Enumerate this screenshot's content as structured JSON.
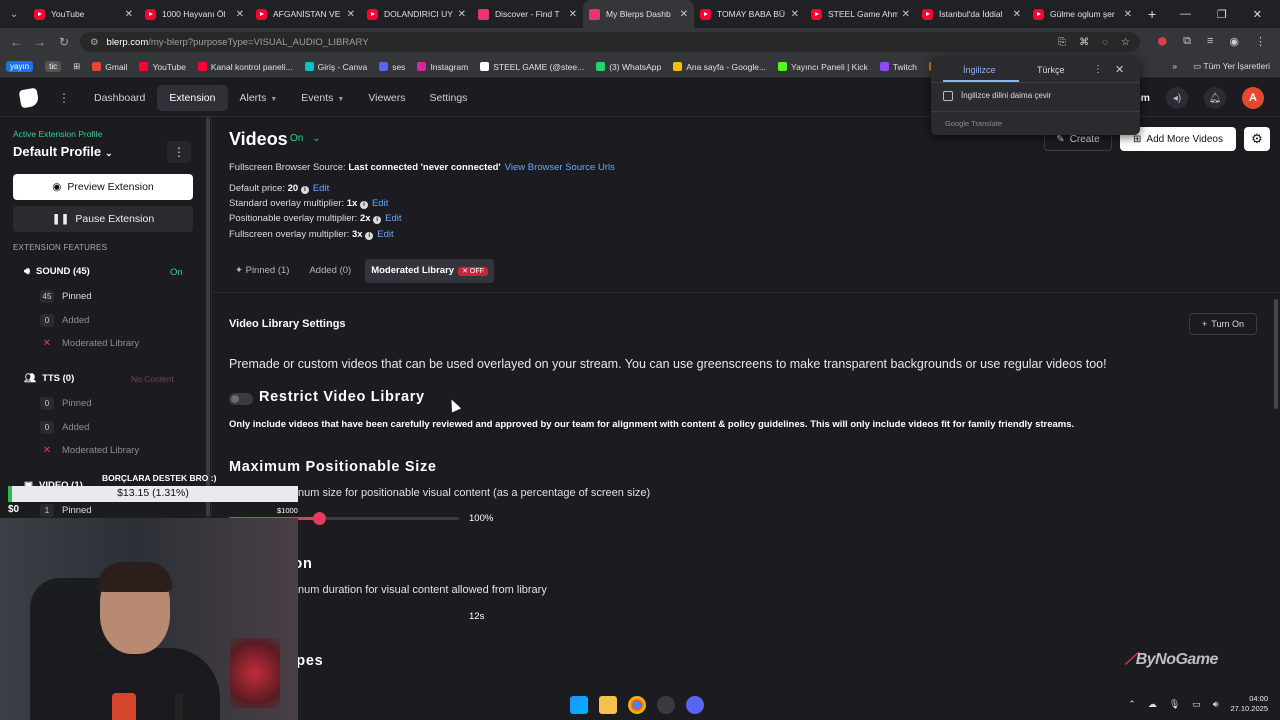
{
  "browser": {
    "tabs": [
      {
        "title": "YouTube",
        "favicon": "youtube-icon",
        "active": false
      },
      {
        "title": "1000 Hayvanı Öl",
        "favicon": "youtube-icon",
        "active": false
      },
      {
        "title": "AFGANİSTAN VE",
        "favicon": "youtube-icon",
        "active": false
      },
      {
        "title": "DOLANDIRICI UY",
        "favicon": "youtube-icon",
        "active": false
      },
      {
        "title": "Discover - Find T",
        "favicon": "blerp-icon",
        "active": false
      },
      {
        "title": "My Blerps Dashb",
        "favicon": "blerp-icon",
        "active": true
      },
      {
        "title": "TOMAY BABA BÜ",
        "favicon": "youtube-icon",
        "active": false
      },
      {
        "title": "STEEL Game Ahm",
        "favicon": "youtube-icon",
        "active": false
      },
      {
        "title": "İstanbul'da İddial",
        "favicon": "youtube-icon",
        "active": false
      },
      {
        "title": "Gülme oglum şer",
        "favicon": "youtube-icon",
        "active": false
      }
    ],
    "new_tab": "+",
    "url_host": "blerp.com",
    "url_path": "/my-blerp?purposeType=VISUAL_AUDIO_LIBRARY",
    "bookmarks": [
      {
        "label": "Gmail",
        "color": "#ea4335"
      },
      {
        "label": "YouTube",
        "color": "#ff0033"
      },
      {
        "label": "Kanal kontrol paneli...",
        "color": "#ff0033"
      },
      {
        "label": "Giriş - Canva",
        "color": "#00c4cc"
      },
      {
        "label": "ses",
        "color": "#5865f2"
      },
      {
        "label": "Instagram",
        "color": "#d6249f"
      },
      {
        "label": "STEEL GAME (@stee...",
        "color": "#ffffff"
      },
      {
        "label": "(3) WhatsApp",
        "color": "#25d366"
      },
      {
        "label": "Ana sayfa - Google...",
        "color": "#fbbc04"
      },
      {
        "label": "Yayıncı Paneli | Kick",
        "color": "#53fc18"
      },
      {
        "label": "Twitch",
        "color": "#9146ff"
      },
      {
        "label": "Donate",
        "color": "#ff7a00"
      }
    ],
    "bookmark_badges": [
      "yayın",
      "tic"
    ],
    "bookmarks_right": "Tüm Yer İşaretleri"
  },
  "translate": {
    "tab_from": "İngilizce",
    "tab_to": "Türkçe",
    "checkbox_label": "İngilizce dilini daima çevir",
    "footer": "Google Translate"
  },
  "app": {
    "nav": [
      {
        "label": "Dashboard",
        "caret": false,
        "active": false
      },
      {
        "label": "Extension",
        "caret": false,
        "active": true
      },
      {
        "label": "Alerts",
        "caret": true,
        "active": false
      },
      {
        "label": "Events",
        "caret": true,
        "active": false
      },
      {
        "label": "Viewers",
        "caret": false,
        "active": false
      },
      {
        "label": "Settings",
        "caret": false,
        "active": false
      }
    ],
    "header_right_text": "om",
    "avatar_letter": "A"
  },
  "sidebar": {
    "profile_label": "Active Extension Profile",
    "profile_name": "Default Profile",
    "preview_button": "Preview Extension",
    "pause_button": "Pause Extension",
    "features_label": "EXTENSION FEATURES",
    "sound": {
      "label": "SOUND (45)",
      "status": "On",
      "pinned_count": "45",
      "pinned": "Pinned",
      "added_count": "0",
      "added": "Added",
      "moderated": "Moderated Library"
    },
    "tts": {
      "label": "TTS (0)",
      "status": "No Content",
      "pinned_count": "0",
      "pinned": "Pinned",
      "added_count": "0",
      "added": "Added",
      "moderated": "Moderated Library"
    },
    "video": {
      "label": "VIDEO (1)",
      "pinned_count": "1",
      "pinned": "Pinned"
    }
  },
  "main": {
    "title": "Videos",
    "status": "On",
    "create_button": "Create",
    "add_more_button": "Add More Videos",
    "browser_source_label": "Fullscreen Browser Source:",
    "browser_source_value": "Last connected 'never connected'",
    "browser_source_link": "View Browser Source Urls",
    "price_label": "Default price:",
    "price_value": "20",
    "standard_label": "Standard overlay multiplier:",
    "standard_value": "1x",
    "positionable_label": "Positionable overlay multiplier:",
    "positionable_value": "2x",
    "fullscreen_label": "Fullscreen overlay multiplier:",
    "fullscreen_value": "3x",
    "edit": "Edit",
    "tabs": {
      "pinned": "Pinned (1)",
      "added": "Added (0)",
      "moderated": "Moderated Library",
      "moderated_badge": "OFF"
    },
    "section_title": "Video Library Settings",
    "turn_on_button": "Turn On",
    "description": "Premade or custom videos that can be used overlayed on your stream. You can use greenscreens to make transparent backgrounds or use regular videos too!",
    "restrict_title": "Restrict Video Library",
    "restrict_desc": "Only include videos that have been carefully reviewed and approved by our team for alignment with content & policy guidelines. This will only include videos fit for family friendly streams.",
    "max_size_title": "Maximum Positionable Size",
    "max_size_desc": "num size for positionable visual content (as a percentage of screen size)",
    "max_size_value": "100%",
    "max_size_fraction": 1.0,
    "duration_title": "m Duration",
    "duration_desc": "num duration for visual content allowed from library",
    "duration_value": "12s",
    "display_title": "isplay Types",
    "watermark": "ByNoGame"
  },
  "overlay": {
    "donation_title": "BORÇLARA DESTEK BRO :)",
    "donation_amount": "$13.15 (1.31%)",
    "donation_fraction": 0.0131,
    "donation_min": "$0",
    "donation_max": "$1000"
  },
  "taskbar": {
    "time": "04:00",
    "date": "27.10.2025"
  }
}
